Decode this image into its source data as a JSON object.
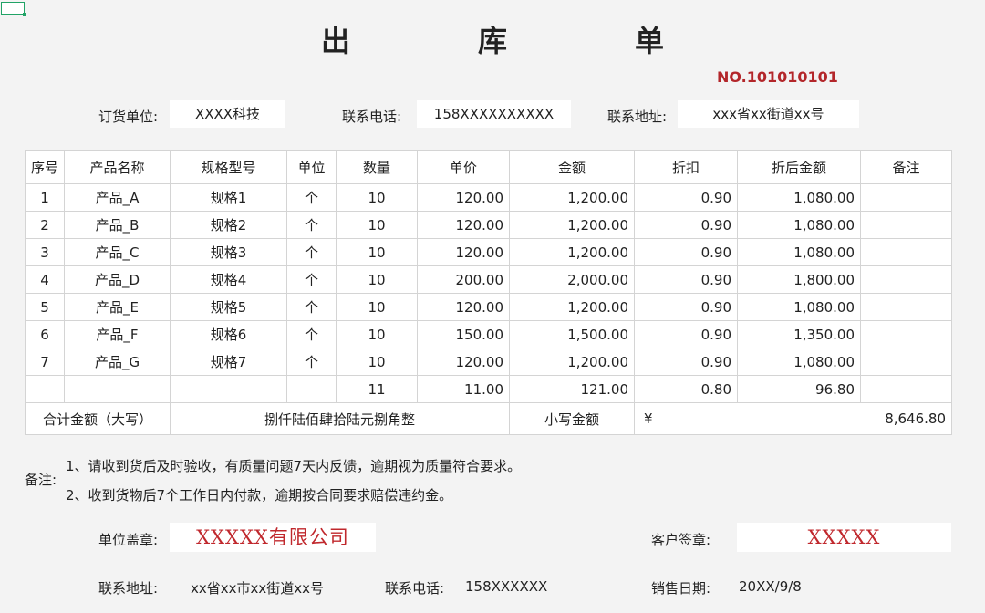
{
  "title": "出　库　单",
  "doc_no": "NO.101010101",
  "header": {
    "order_unit_label": "订货单位:",
    "order_unit_value": "XXXX科技",
    "phone_label": "联系电话:",
    "phone_value": "158XXXXXXXXXX",
    "address_label": "联系地址:",
    "address_value": "xxx省xx街道xx号"
  },
  "table": {
    "columns": [
      "序号",
      "产品名称",
      "规格型号",
      "单位",
      "数量",
      "单价",
      "金额",
      "折扣",
      "折后金额",
      "备注"
    ],
    "rows": [
      [
        "1",
        "产品_A",
        "规格1",
        "个",
        "10",
        "120.00",
        "1,200.00",
        "0.90",
        "1,080.00",
        ""
      ],
      [
        "2",
        "产品_B",
        "规格2",
        "个",
        "10",
        "120.00",
        "1,200.00",
        "0.90",
        "1,080.00",
        ""
      ],
      [
        "3",
        "产品_C",
        "规格3",
        "个",
        "10",
        "120.00",
        "1,200.00",
        "0.90",
        "1,080.00",
        ""
      ],
      [
        "4",
        "产品_D",
        "规格4",
        "个",
        "10",
        "200.00",
        "2,000.00",
        "0.90",
        "1,800.00",
        ""
      ],
      [
        "5",
        "产品_E",
        "规格5",
        "个",
        "10",
        "120.00",
        "1,200.00",
        "0.90",
        "1,080.00",
        ""
      ],
      [
        "6",
        "产品_F",
        "规格6",
        "个",
        "10",
        "150.00",
        "1,500.00",
        "0.90",
        "1,350.00",
        ""
      ],
      [
        "7",
        "产品_G",
        "规格7",
        "个",
        "10",
        "120.00",
        "1,200.00",
        "0.90",
        "1,080.00",
        ""
      ]
    ],
    "subtotal": [
      "",
      "",
      "",
      "",
      "11",
      "11.00",
      "121.00",
      "0.80",
      "96.80",
      ""
    ],
    "total": {
      "upper_label": "合计金额（大写）",
      "upper_value": "捌仟陆佰肆拾陆元捌角整",
      "lower_label": "小写金额",
      "currency": "¥",
      "lower_value": "8,646.80"
    }
  },
  "notes": {
    "label": "备注:",
    "line1": "1、请收到货后及时验收，有质量问题7天内反馈，逾期视为质量符合要求。",
    "line2": "2、收到货物后7个工作日内付款，逾期按合同要求赔偿违约金。"
  },
  "footer": {
    "seal_label": "单位盖章:",
    "seal_value": "XXXXX有限公司",
    "customer_sign_label": "客户签章:",
    "customer_sign_value": "XXXXX",
    "address_label": "联系地址:",
    "address_value": "xx省xx市xx街道xx号",
    "phone_label": "联系电话:",
    "phone_value": "158XXXXXX",
    "date_label": "销售日期:",
    "date_value": "20XX/9/8"
  },
  "colors": {
    "accent_red": "#b3262a",
    "stamp_red": "#c0282d",
    "selection_green": "#21a366"
  }
}
